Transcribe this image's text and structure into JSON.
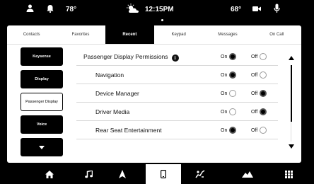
{
  "status": {
    "outside_temp": "78°",
    "time": "12:15PM",
    "inside_temp": "68°",
    "icons": [
      "user-icon",
      "bell-icon",
      "weather-icon",
      "camera-icon",
      "microphone-icon"
    ]
  },
  "tabs": [
    {
      "label": "Contacts",
      "active": false
    },
    {
      "label": "Favorites",
      "active": false
    },
    {
      "label": "Recent",
      "active": true
    },
    {
      "label": "Keypad",
      "active": false
    },
    {
      "label": "Messages",
      "active": false
    },
    {
      "label": "On Call",
      "active": false
    }
  ],
  "sidenav": [
    {
      "label": "Keysense",
      "selected": false
    },
    {
      "label": "Display",
      "selected": false
    },
    {
      "label": "Passenger Display",
      "selected": true
    },
    {
      "label": "Voice",
      "selected": false
    },
    {
      "label": "more-down-icon",
      "selected": false
    }
  ],
  "settings": {
    "on_label": "On",
    "off_label": "Off",
    "rows": [
      {
        "label": "Passenger Display Permissions",
        "value": "On",
        "info": true
      },
      {
        "label": "Navigation",
        "value": "On"
      },
      {
        "label": "Device Manager",
        "value": "Off"
      },
      {
        "label": "Driver Media",
        "value": "Off"
      },
      {
        "label": "Rear Seat Entertainment",
        "value": "On"
      }
    ]
  },
  "bottom_nav": [
    {
      "icon": "home-icon",
      "active": false
    },
    {
      "icon": "music-icon",
      "active": false
    },
    {
      "icon": "navigation-icon",
      "active": false
    },
    {
      "icon": "phone-icon",
      "active": true
    },
    {
      "icon": "hands-free-icon",
      "active": false
    },
    {
      "icon": "off-road-icon",
      "active": false
    },
    {
      "icon": "apps-grid-icon",
      "active": false
    }
  ],
  "colors": {
    "background": "#000000",
    "panel": "#ffffff",
    "accent": "#000000"
  }
}
